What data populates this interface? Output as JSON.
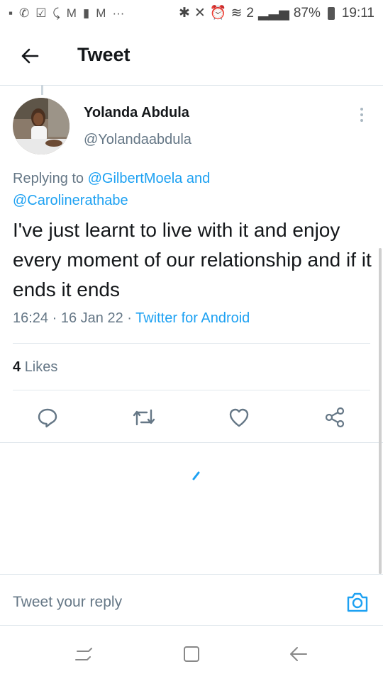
{
  "status_bar": {
    "left_icons": [
      "chat-icon",
      "missed-call-icon",
      "checkbox-icon",
      "missed-call-icon",
      "gmail-icon",
      "person-icon",
      "gmail-icon",
      "more-dots-icon"
    ],
    "left_glyphs": [
      "▪",
      "✆",
      "☑",
      "⤹",
      "M",
      "▮",
      "M",
      "···"
    ],
    "right_glyphs": [
      "✱",
      "✕",
      "⏰",
      "≋",
      "2",
      "▂▃▅"
    ],
    "battery": "87%",
    "time": "19:11"
  },
  "header": {
    "title": "Tweet"
  },
  "tweet": {
    "author_name": "Yolanda Abdula",
    "author_handle": "@Yolandaabdula",
    "replying_prefix": "Replying to",
    "replying_user1": "@GilbertMoela",
    "replying_and": "and",
    "replying_user2": "@Carolinerathabe",
    "text": "I've just learnt to live with it and enjoy every moment of our relationship and if it ends it ends",
    "time": "16:24",
    "date": "16 Jan 22",
    "source": "Twitter for Android",
    "likes_count": "4",
    "likes_label": "Likes"
  },
  "reply_bar": {
    "placeholder": "Tweet your reply"
  },
  "colors": {
    "accent": "#1da1f2",
    "secondary_text": "#657786",
    "divider": "#e1e8ed"
  }
}
